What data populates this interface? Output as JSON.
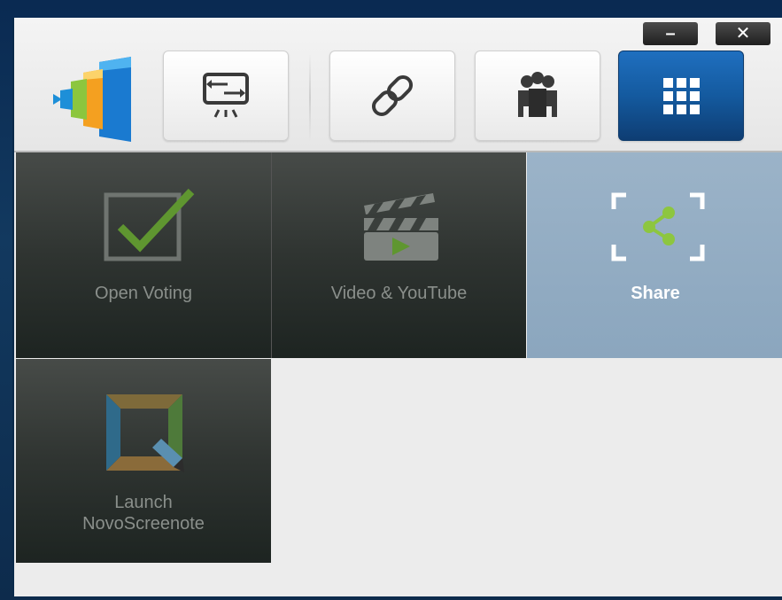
{
  "window": {
    "minimize_label": "–",
    "close_label": "✕"
  },
  "toolbar": {
    "buttons": [
      {
        "name": "screen-mirror",
        "icon": "screen-switch-icon"
      },
      {
        "name": "link",
        "icon": "link-icon"
      },
      {
        "name": "group",
        "icon": "group-people-icon"
      },
      {
        "name": "apps",
        "icon": "app-grid-icon",
        "active": true
      }
    ]
  },
  "tiles": [
    {
      "label": "Open Voting",
      "icon": "checkbox-voting-icon"
    },
    {
      "label": "Video & YouTube",
      "icon": "clapperboard-video-icon"
    },
    {
      "label": "Share",
      "icon": "share-icon",
      "selected": true
    },
    {
      "label_line1": "Launch",
      "label_line2": "NovoScreenote",
      "icon": "screenote-icon"
    }
  ],
  "colors": {
    "accent": "#145a9f",
    "selected_tile": "#8ba6be",
    "share_green": "#8dc63f"
  }
}
